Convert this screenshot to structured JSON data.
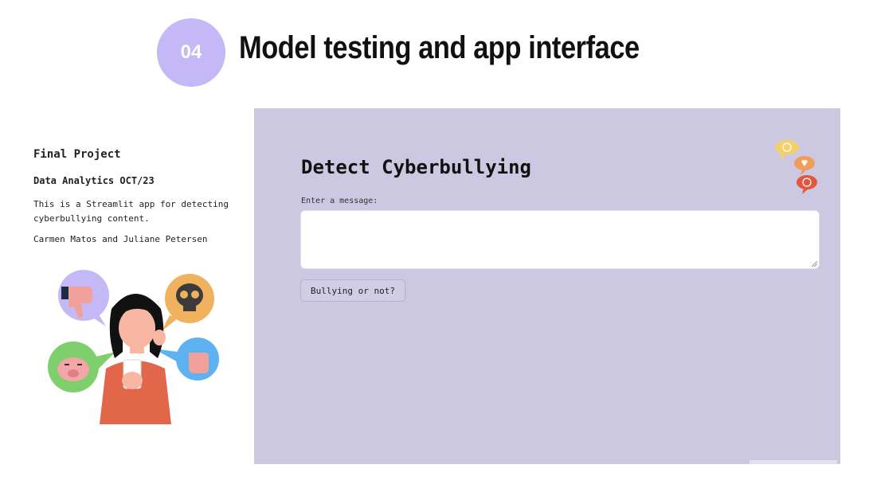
{
  "slide": {
    "number": "04",
    "title": "Model testing and app interface"
  },
  "sidebar": {
    "project": "Final Project",
    "course": "Data Analytics OCT/23",
    "description": "This is a Streamlit app for detecting cyberbullying content.",
    "authors": "Carmen Matos and Juliane Petersen"
  },
  "app": {
    "title": "Detect Cyberbullying",
    "input_label": "Enter a message:",
    "input_value": "",
    "button_label": "Bullying or not?"
  },
  "colors": {
    "badge": "#c4b8f7",
    "app_background": "#cdc8e2"
  },
  "icons": [
    "speech-bubbles-icon",
    "thumbs-down-icon",
    "skull-icon",
    "pig-icon",
    "fist-icon",
    "smartphone-icon"
  ]
}
